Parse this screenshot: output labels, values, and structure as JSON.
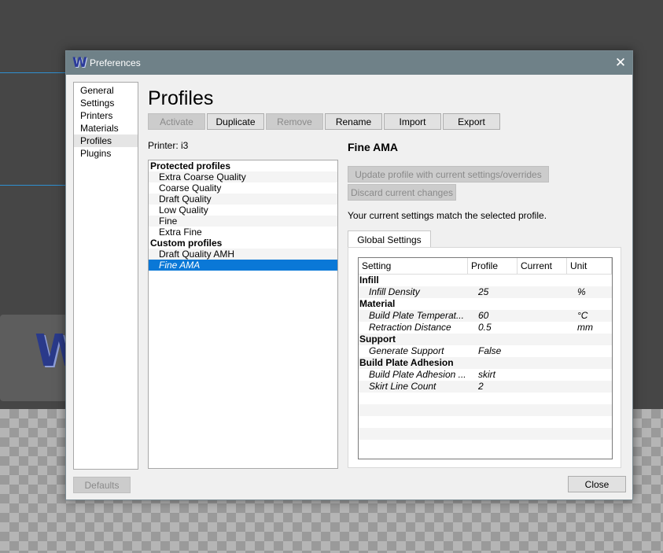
{
  "window": {
    "title": "Preferences",
    "close_glyph": "✕",
    "icon": "app-logo-icon"
  },
  "sidebar": {
    "items": [
      {
        "label": "General"
      },
      {
        "label": "Settings"
      },
      {
        "label": "Printers"
      },
      {
        "label": "Materials"
      },
      {
        "label": "Profiles",
        "active": true
      },
      {
        "label": "Plugins"
      }
    ],
    "defaults_label": "Defaults"
  },
  "page": {
    "title": "Profiles",
    "printer_label": "Printer: i3"
  },
  "toolbar": {
    "activate": "Activate",
    "duplicate": "Duplicate",
    "remove": "Remove",
    "rename": "Rename",
    "import": "Import",
    "export": "Export"
  },
  "profiles": {
    "protected_header": "Protected profiles",
    "protected": [
      "Extra Coarse Quality",
      "Coarse Quality",
      "Draft Quality",
      "Low Quality",
      "Fine",
      "Extra Fine"
    ],
    "custom_header": "Custom profiles",
    "custom": [
      "Draft Quality AMH",
      "Fine AMA"
    ],
    "selected": "Fine AMA"
  },
  "detail": {
    "title": "Fine AMA",
    "update_button": "Update profile with current settings/overrides",
    "discard_button": "Discard current changes",
    "message": "Your current settings match the selected profile.",
    "tab": "Global Settings"
  },
  "table": {
    "headers": [
      "Setting",
      "Profile",
      "Current",
      "Unit"
    ],
    "rows": [
      {
        "type": "cat",
        "setting": "Infill"
      },
      {
        "type": "setting",
        "setting": "Infill Density",
        "profile": "25",
        "current": "",
        "unit": "%"
      },
      {
        "type": "cat",
        "setting": "Material"
      },
      {
        "type": "setting",
        "setting": "Build Plate Temperat...",
        "profile": "60",
        "current": "",
        "unit": "°C"
      },
      {
        "type": "setting",
        "setting": "Retraction Distance",
        "profile": "0.5",
        "current": "",
        "unit": "mm"
      },
      {
        "type": "cat",
        "setting": "Support"
      },
      {
        "type": "setting",
        "setting": "Generate Support",
        "profile": "False",
        "current": "",
        "unit": ""
      },
      {
        "type": "cat",
        "setting": "Build Plate Adhesion"
      },
      {
        "type": "setting",
        "setting": "Build Plate Adhesion ...",
        "profile": "skirt",
        "current": "",
        "unit": ""
      },
      {
        "type": "setting",
        "setting": "Skirt Line Count",
        "profile": "2",
        "current": "",
        "unit": ""
      }
    ]
  },
  "footer": {
    "close_label": "Close"
  }
}
